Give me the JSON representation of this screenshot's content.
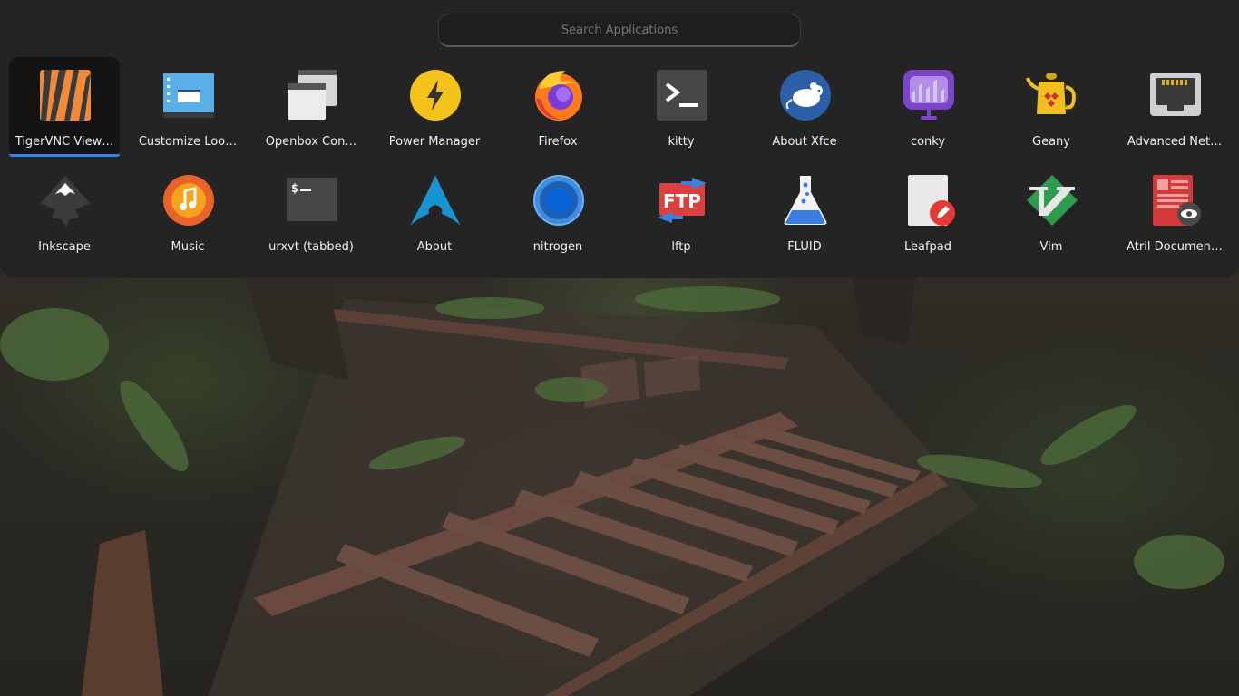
{
  "search": {
    "placeholder": "Search Applications"
  },
  "apps_row1": [
    {
      "label": "TigerVNC View…",
      "icon": "tigervnc-icon",
      "selected": true
    },
    {
      "label": "Customize Loo…",
      "icon": "appearance-icon"
    },
    {
      "label": "Openbox Con…",
      "icon": "openbox-config-icon"
    },
    {
      "label": "Power Manager",
      "icon": "power-manager-icon"
    },
    {
      "label": "Firefox",
      "icon": "firefox-icon"
    },
    {
      "label": "kitty",
      "icon": "kitty-terminal-icon"
    },
    {
      "label": "About Xfce",
      "icon": "xfce-mouse-icon"
    },
    {
      "label": "conky",
      "icon": "conky-icon"
    },
    {
      "label": "Geany",
      "icon": "geany-teapot-icon"
    },
    {
      "label": "Advanced Net…",
      "icon": "network-ethernet-icon"
    }
  ],
  "apps_row2": [
    {
      "label": "Inkscape",
      "icon": "inkscape-icon"
    },
    {
      "label": "Music",
      "icon": "music-note-icon"
    },
    {
      "label": "urxvt (tabbed)",
      "icon": "urxvt-terminal-icon"
    },
    {
      "label": "About",
      "icon": "arch-logo-icon"
    },
    {
      "label": "nitrogen",
      "icon": "nitrogen-icon"
    },
    {
      "label": "lftp",
      "icon": "ftp-icon"
    },
    {
      "label": "FLUID",
      "icon": "flask-icon"
    },
    {
      "label": "Leafpad",
      "icon": "text-editor-icon"
    },
    {
      "label": "Vim",
      "icon": "vim-icon"
    },
    {
      "label": "Atril Documen…",
      "icon": "document-viewer-icon"
    }
  ],
  "colors": {
    "panel": "#242424",
    "selection_accent": "#3584e4"
  }
}
